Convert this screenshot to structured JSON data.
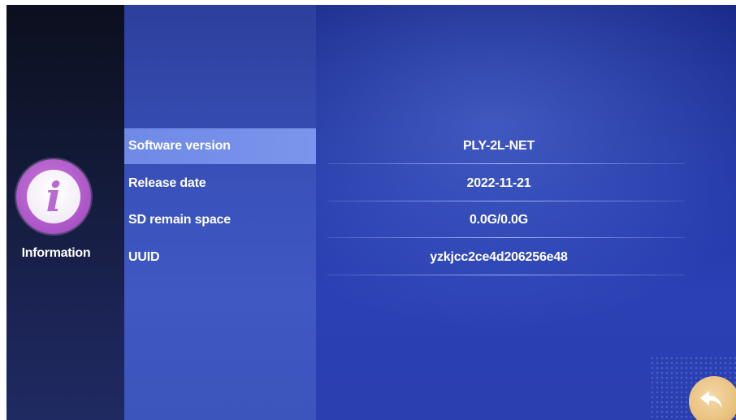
{
  "sidebar": {
    "icon": "info-icon",
    "icon_glyph": "i",
    "label": "Information"
  },
  "info_rows": [
    {
      "label": "Software version",
      "value": "PLY-2L-NET",
      "selected": true
    },
    {
      "label": "Release date",
      "value": "2022-11-21",
      "selected": false
    },
    {
      "label": "SD remain space",
      "value": "0.0G/0.0G",
      "selected": false
    },
    {
      "label": "UUID",
      "value": "yzkjcc2ce4d206256e48",
      "selected": false
    }
  ],
  "back_button": {
    "icon": "back-arrow-icon"
  },
  "colors": {
    "icon_purple": "#b25ccc",
    "selected_row": "#7b95ec",
    "back_button": "#e9c27e"
  }
}
